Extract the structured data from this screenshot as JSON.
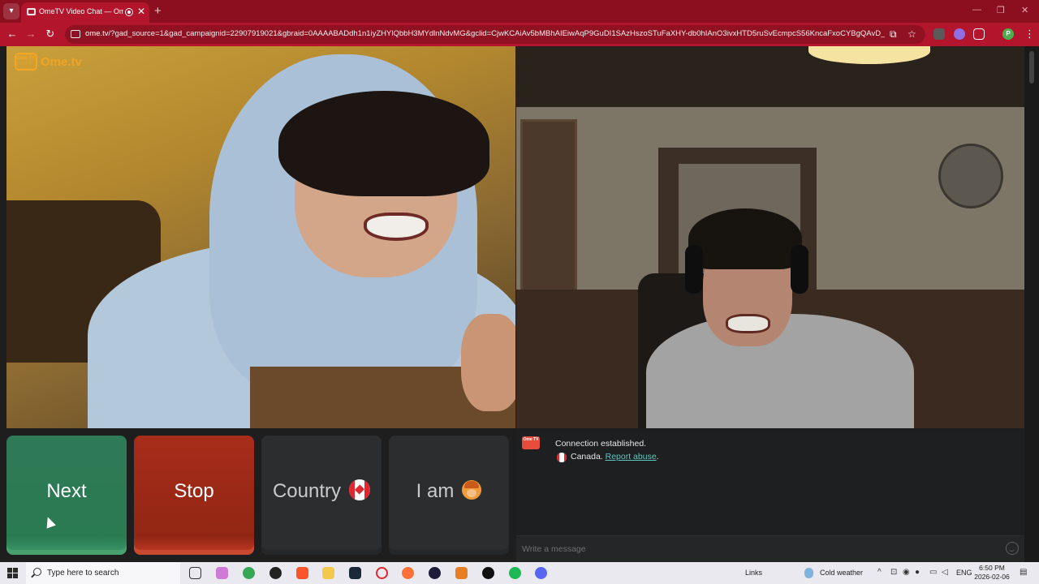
{
  "browser": {
    "tab_title": "OmeTV Video Chat — Ome",
    "tab_close": "✕",
    "new_tab": "+",
    "url_host": "ome.tv",
    "url_rest": "/?gad_source=1&gad_campaignid=22907919021&gbraid=0AAAABADdh1n1iyZHYlQbbH3MYdlnNdvMG&gclid=CjwKCAiAv5bMBhAIEiwAqP9GuDI1SAzHszoSTuFaXHY-db0hIAnO3ivxHTD5ruSvEcmpcS56KncaFxoCYBgQAvD_BwE",
    "profile_initial": "P",
    "window_controls": [
      "—",
      "❐",
      "✕"
    ]
  },
  "page": {
    "logo_box": "Ome TV",
    "logo_text": "Ome.tv",
    "buttons": {
      "next": "Next",
      "stop": "Stop",
      "country": "Country",
      "iam": "I am"
    },
    "chat": {
      "logo_small": "Ome TV",
      "connection": "Connection established.",
      "country": "Canada.",
      "report": "Report abuse",
      "period": ".",
      "placeholder": "Write a message"
    }
  },
  "taskbar": {
    "search_placeholder": "Type here to search",
    "links": "Links",
    "weather": "Cold weather",
    "language": "ENG",
    "time": "6:50 PM",
    "date": "2026-02-06"
  },
  "colors": {
    "accent_chrome": "#b3162c",
    "next_green": "#2f7a57",
    "stop_red": "#a82c1a",
    "link_teal": "#5fc5c0",
    "logo_orange": "#f5a623"
  }
}
